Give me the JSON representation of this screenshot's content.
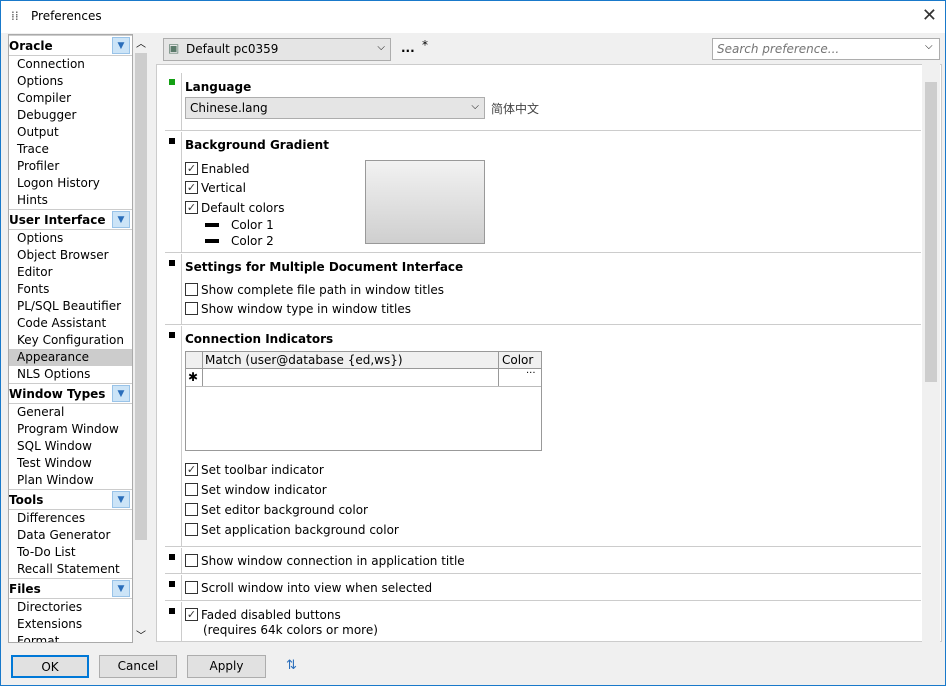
{
  "window": {
    "title": "Preferences",
    "close": "✕"
  },
  "sidebar": {
    "groups": [
      {
        "label": "Oracle",
        "items": [
          "Connection",
          "Options",
          "Compiler",
          "Debugger",
          "Output",
          "Trace",
          "Profiler",
          "Logon History",
          "Hints"
        ]
      },
      {
        "label": "User Interface",
        "items": [
          "Options",
          "Object Browser",
          "Editor",
          "Fonts",
          "PL/SQL Beautifier",
          "Code Assistant",
          "Key Configuration",
          "Appearance",
          "NLS Options"
        ],
        "selected": "Appearance"
      },
      {
        "label": "Window Types",
        "items": [
          "General",
          "Program Window",
          "SQL Window",
          "Test Window",
          "Plan Window"
        ]
      },
      {
        "label": "Tools",
        "items": [
          "Differences",
          "Data Generator",
          "To-Do List",
          "Recall Statement"
        ]
      },
      {
        "label": "Files",
        "items": [
          "Directories",
          "Extensions",
          "Format"
        ]
      }
    ]
  },
  "toolbar": {
    "profile": "Default pc0359",
    "more": "...",
    "modified": "*",
    "search_placeholder": "Search preference..."
  },
  "language": {
    "heading": "Language",
    "value": "Chinese.lang",
    "native": "简体中文"
  },
  "gradient": {
    "heading": "Background Gradient",
    "enabled": {
      "label": "Enabled",
      "checked": true
    },
    "vertical": {
      "label": "Vertical",
      "checked": true
    },
    "default_colors": {
      "label": "Default colors",
      "checked": true
    },
    "color1": "Color 1",
    "color2": "Color 2"
  },
  "mdi": {
    "heading": "Settings for Multiple Document Interface",
    "path": {
      "label": "Show complete file path in window titles",
      "checked": false
    },
    "type": {
      "label": "Show window type in window titles",
      "checked": false
    }
  },
  "conn": {
    "heading": "Connection Indicators",
    "col_match": "Match (user@database {ed,ws})",
    "col_color": "Color",
    "new_row": "✱",
    "ellipsis": "···",
    "toolbar": {
      "label": "Set toolbar indicator",
      "checked": true
    },
    "window": {
      "label": "Set window indicator",
      "checked": false
    },
    "editor": {
      "label": "Set editor background color",
      "checked": false
    },
    "app": {
      "label": "Set application background color",
      "checked": false
    }
  },
  "show_conn": {
    "label": "Show window connection in application title",
    "checked": false
  },
  "scroll": {
    "label": "Scroll window into view when selected",
    "checked": false
  },
  "faded": {
    "label": "Faded disabled buttons",
    "checked": true,
    "note": "(requires 64k colors or more)"
  },
  "buttons": {
    "ok": "OK",
    "cancel": "Cancel",
    "apply": "Apply"
  }
}
